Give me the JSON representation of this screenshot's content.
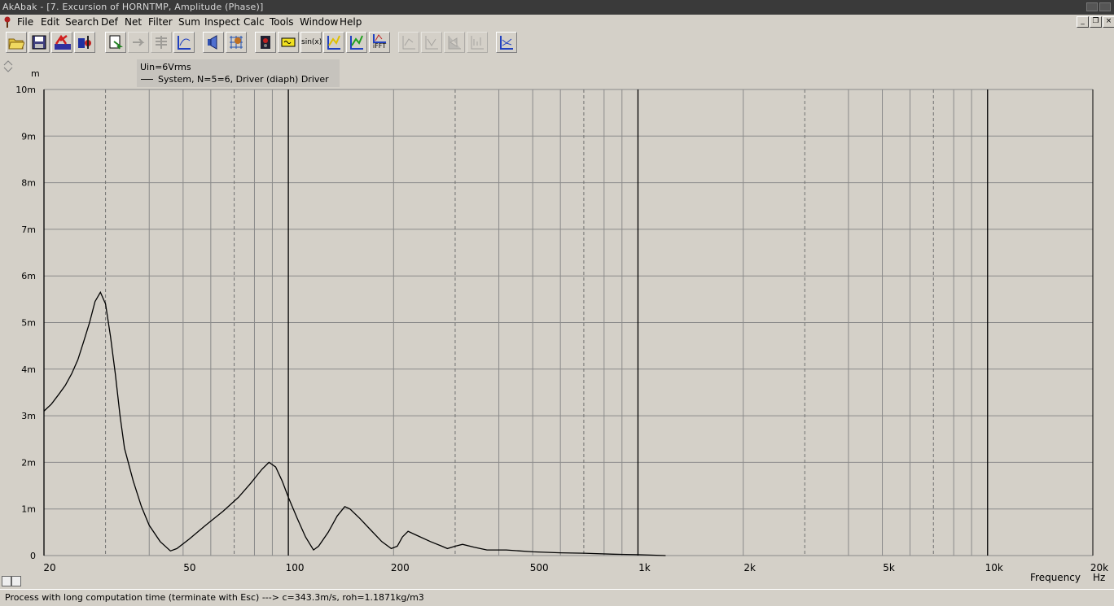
{
  "window": {
    "title": "AkAbak - [7. Excursion of HORNTMP, Amplitude (Phase)]"
  },
  "menu": {
    "items": [
      {
        "label": "File"
      },
      {
        "label": "Edit"
      },
      {
        "label": "Search"
      },
      {
        "label": "Def"
      },
      {
        "label": "Net"
      },
      {
        "label": "Filter"
      },
      {
        "label": "Sum"
      },
      {
        "label": "Inspect"
      },
      {
        "label": "Calc"
      },
      {
        "label": "Tools"
      },
      {
        "label": "Window"
      },
      {
        "label": "Help"
      }
    ]
  },
  "toolbar": {
    "buttons": [
      {
        "icon": "open-folder-icon",
        "enabled": true
      },
      {
        "icon": "save-icon",
        "enabled": true
      },
      {
        "icon": "network-script-icon",
        "enabled": true
      },
      {
        "icon": "driver-flag-icon",
        "enabled": true
      },
      {
        "icon": "document-arrow-icon",
        "enabled": true
      },
      {
        "icon": "arrow-step-icon",
        "enabled": false
      },
      {
        "icon": "stack-lines-icon",
        "enabled": false
      },
      {
        "icon": "graph-axes-icon",
        "enabled": true
      },
      {
        "icon": "loudspeaker-icon",
        "enabled": true
      },
      {
        "icon": "grid-target-icon",
        "enabled": true
      },
      {
        "icon": "speaker-box-icon",
        "enabled": true
      },
      {
        "icon": "yellow-filter-icon",
        "enabled": true
      },
      {
        "icon": "sin-function-icon",
        "enabled": true,
        "text": "sin(x)"
      },
      {
        "icon": "star-plot-icon",
        "enabled": true
      },
      {
        "icon": "green-plot-icon",
        "enabled": true
      },
      {
        "icon": "ifft-icon",
        "enabled": true,
        "text": "iFFT"
      },
      {
        "icon": "disabled-plot-a-icon",
        "enabled": false
      },
      {
        "icon": "disabled-plot-b-icon",
        "enabled": false
      },
      {
        "icon": "disabled-plot-c-icon",
        "enabled": false
      },
      {
        "icon": "disabled-plot-d-icon",
        "enabled": false
      },
      {
        "icon": "plot-compare-icon",
        "enabled": true
      }
    ]
  },
  "legend": {
    "header": "Uin=6Vrms",
    "series_label": "System, N=5=6, Driver (diaph) Driver"
  },
  "chart_data": {
    "type": "line",
    "ylabel": "m",
    "xlabel": "Frequency",
    "x_unit": "Hz",
    "x_scale": "log",
    "xlim": [
      20,
      20000
    ],
    "ylim": [
      0,
      10
    ],
    "y_ticks": [
      "0",
      "1m",
      "2m",
      "3m",
      "4m",
      "5m",
      "6m",
      "7m",
      "8m",
      "9m",
      "10m"
    ],
    "x_ticks": [
      {
        "value": 20,
        "label": "20"
      },
      {
        "value": 50,
        "label": "50"
      },
      {
        "value": 100,
        "label": "100"
      },
      {
        "value": 200,
        "label": "200"
      },
      {
        "value": 500,
        "label": "500"
      },
      {
        "value": 1000,
        "label": "1k"
      },
      {
        "value": 2000,
        "label": "2k"
      },
      {
        "value": 5000,
        "label": "5k"
      },
      {
        "value": 10000,
        "label": "10k"
      },
      {
        "value": 20000,
        "label": "20k"
      }
    ],
    "grid": true,
    "series": [
      {
        "name": "System, N=5=6, Driver (diaph) Driver",
        "color": "#000000",
        "points": [
          [
            20,
            3.1
          ],
          [
            21,
            3.25
          ],
          [
            22,
            3.45
          ],
          [
            23,
            3.65
          ],
          [
            24,
            3.9
          ],
          [
            25,
            4.2
          ],
          [
            26,
            4.6
          ],
          [
            27,
            5.0
          ],
          [
            28,
            5.45
          ],
          [
            29,
            5.65
          ],
          [
            30,
            5.4
          ],
          [
            31,
            4.7
          ],
          [
            32,
            3.9
          ],
          [
            33,
            3.0
          ],
          [
            34,
            2.3
          ],
          [
            36,
            1.6
          ],
          [
            38,
            1.05
          ],
          [
            40,
            0.65
          ],
          [
            43,
            0.3
          ],
          [
            46,
            0.1
          ],
          [
            48,
            0.15
          ],
          [
            52,
            0.35
          ],
          [
            58,
            0.65
          ],
          [
            65,
            0.95
          ],
          [
            72,
            1.25
          ],
          [
            78,
            1.55
          ],
          [
            84,
            1.85
          ],
          [
            88,
            2.0
          ],
          [
            92,
            1.9
          ],
          [
            96,
            1.6
          ],
          [
            100,
            1.25
          ],
          [
            106,
            0.8
          ],
          [
            112,
            0.4
          ],
          [
            118,
            0.12
          ],
          [
            122,
            0.2
          ],
          [
            130,
            0.5
          ],
          [
            138,
            0.85
          ],
          [
            145,
            1.05
          ],
          [
            150,
            1.0
          ],
          [
            160,
            0.8
          ],
          [
            172,
            0.55
          ],
          [
            185,
            0.3
          ],
          [
            197,
            0.15
          ],
          [
            205,
            0.2
          ],
          [
            212,
            0.4
          ],
          [
            220,
            0.52
          ],
          [
            235,
            0.42
          ],
          [
            255,
            0.3
          ],
          [
            275,
            0.2
          ],
          [
            285,
            0.15
          ],
          [
            300,
            0.2
          ],
          [
            315,
            0.24
          ],
          [
            340,
            0.18
          ],
          [
            370,
            0.12
          ],
          [
            420,
            0.12
          ],
          [
            500,
            0.08
          ],
          [
            600,
            0.06
          ],
          [
            700,
            0.05
          ],
          [
            850,
            0.03
          ],
          [
            1000,
            0.02
          ],
          [
            1200,
            0.0
          ]
        ]
      }
    ]
  },
  "status": {
    "text": "Process with long computation time (terminate with Esc) ---> c=343.3m/s, roh=1.1871kg/m3"
  }
}
